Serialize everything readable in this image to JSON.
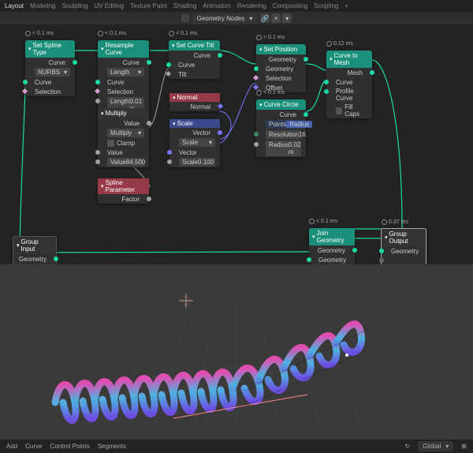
{
  "tabs": [
    "Layout",
    "Modeling",
    "Sculpting",
    "UV Editing",
    "Texture Paint",
    "Shading",
    "Animation",
    "Rendering",
    "Compositing",
    "Scripting"
  ],
  "activeTab": "Layout",
  "nodetree_label": "Geometry Nodes",
  "timings": {
    "generic": "< 0.1 ms",
    "ctm": "0.12 ms",
    "out": "0.37 ms"
  },
  "nodes": {
    "spline": {
      "title": "Set Spline Type",
      "outCurve": "Curve",
      "type": "NURBS",
      "inCurve": "Curve",
      "inSel": "Selection"
    },
    "resample": {
      "title": "Resample Curve",
      "outCurve": "Curve",
      "mode": "Length",
      "inCurve": "Curve",
      "inSel": "Selection",
      "len_l": "Length",
      "len_v": "0.01 m"
    },
    "mult": {
      "title": "Multiply",
      "outVal": "Value",
      "op": "Multiply",
      "clamp": "Clamp",
      "inVal": "Value",
      "val_l": "Value",
      "val_v": "84.500"
    },
    "sparam": {
      "title": "Spline Parameter",
      "outFactor": "Factor"
    },
    "tilt": {
      "title": "Set Curve Tilt",
      "outCurve": "Curve",
      "inCurve": "Curve",
      "inTilt": "Tilt"
    },
    "normal": {
      "title": "Normal",
      "outNormal": "Normal"
    },
    "scale": {
      "title": "Scale",
      "outVec": "Vector",
      "op": "Scale",
      "inVec": "Vector",
      "scale_l": "Scale",
      "scale_v": "0.100"
    },
    "setpos": {
      "title": "Set Position",
      "outGeo": "Geometry",
      "inGeo": "Geometry",
      "inSel": "Selection",
      "inOff": "Offset"
    },
    "circle": {
      "title": "Curve Circle",
      "outCurve": "Curve",
      "mode": "Points",
      "mode2": "Radius",
      "res_l": "Resolution",
      "res_v": "16",
      "rad_l": "Radius",
      "rad_v": "0.02 m"
    },
    "ctm": {
      "title": "Curve to Mesh",
      "outMesh": "Mesh",
      "inCurve": "Curve",
      "inProfile": "Profile Curve",
      "inFill": "Fill Caps"
    },
    "join": {
      "title": "Join Geometry",
      "outGeo": "Geometry",
      "inGeo": "Geometry"
    },
    "gin": {
      "title": "Group Input",
      "outGeo": "Geometry"
    },
    "gout": {
      "title": "Group Output",
      "inGeo": "Geometry"
    }
  },
  "status": {
    "add": "Add",
    "curve": "Curve",
    "cp": "Control Points",
    "seg": "Segments",
    "orient": "Global"
  },
  "colors": {
    "geom": "#1bd9a5",
    "val": "#a0a0a0",
    "vec": "#7878ff",
    "bool": "#d79bd7"
  }
}
